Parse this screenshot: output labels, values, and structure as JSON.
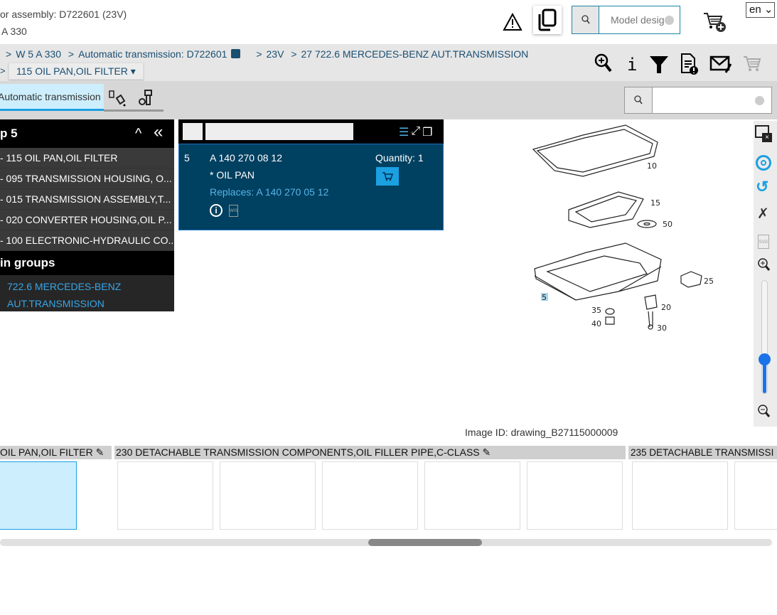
{
  "header": {
    "line1": "or assembly: D722601 (23V)",
    "line2": "A 330",
    "search_placeholder": "Model desig",
    "language": "en",
    "icons": [
      "warning-icon",
      "copy-icon",
      "search-icon",
      "clear-icon",
      "cart-add-icon"
    ]
  },
  "breadcrumb": {
    "items": [
      "W 5 A 330",
      "Automatic transmission: D722601",
      "23V",
      "27 722.6 MERCEDES-BENZ AUT.TRANSMISSION"
    ],
    "separator": ">",
    "dropdown": "115 OIL PAN,OIL FILTER"
  },
  "toolbar": {
    "icons": [
      "zoom-in-icon",
      "info-icon",
      "filter-icon",
      "document-alert-icon",
      "mail-edit-icon",
      "cart-icon"
    ]
  },
  "tabs": {
    "active": "Automatic transmission",
    "icons": [
      "paint-icon",
      "bolt-nut-icon"
    ]
  },
  "sidebar": {
    "title": "p 5",
    "items": [
      "- 115 OIL PAN,OIL FILTER",
      "- 095 TRANSMISSION HOUSING, O...",
      "- 015 TRANSMISSION ASSEMBLY,T...",
      "- 020 CONVERTER HOUSING,OIL P...",
      "- 100 ELECTRONIC-HYDRAULIC CO..."
    ],
    "main_groups_title": "in groups",
    "main_group_link": [
      "722.6 MERCEDES-BENZ",
      "AUT.TRANSMISSION"
    ]
  },
  "part": {
    "pos": "5",
    "number": "A 140 270 08 12",
    "name": "* OIL PAN",
    "replaces": "Replaces: A 140 270 05 12",
    "quantity": "Quantity: 1"
  },
  "drawing": {
    "labels": [
      "10",
      "15",
      "50",
      "5",
      "25",
      "35",
      "20",
      "40",
      "30"
    ],
    "image_id": "Image ID: drawing_B27115000009",
    "zoom_level": 0.3
  },
  "thumbnails": {
    "groups": [
      "OIL PAN,OIL FILTER",
      "230 DETACHABLE TRANSMISSION COMPONENTS,OIL FILLER PIPE,C-CLASS",
      "235 DETACHABLE TRANSMISSI"
    ]
  },
  "colors": {
    "accent": "#1ba0e2",
    "part_bg": "#004060",
    "link": "#38a6e8"
  }
}
